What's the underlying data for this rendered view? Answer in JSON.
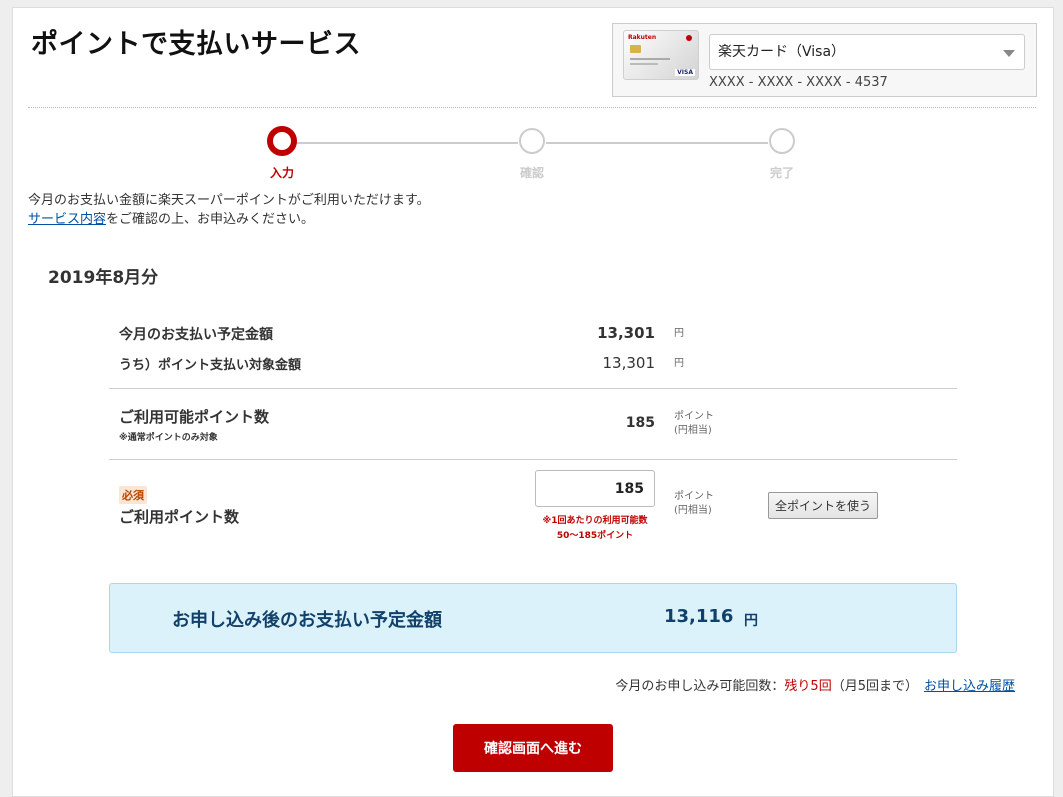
{
  "header": {
    "title": "ポイントで支払いサービス"
  },
  "card": {
    "brand_text": "Rakuten",
    "network_text": "VISA",
    "selected": "楽天カード（Visa）",
    "number": "XXXX - XXXX - XXXX - 4537"
  },
  "steps": [
    {
      "label": "入力",
      "state": "active"
    },
    {
      "label": "確認",
      "state": "inactive"
    },
    {
      "label": "完了",
      "state": "inactive"
    }
  ],
  "intro": {
    "line1": "今月のお支払い金額に楽天スーパーポイントがご利用いただけます。",
    "link": "サービス内容",
    "line2_rest": "をご確認の上、お申込みください。"
  },
  "month": "2019年8月分",
  "summary": {
    "due_label": "今月のお支払い予定金額",
    "due_value": "13,301",
    "due_unit": "円",
    "target_label": "うち）ポイント支払い対象金額",
    "target_value": "13,301",
    "target_unit": "円",
    "available_label": "ご利用可能ポイント数",
    "available_note": "※通常ポイントのみ対象",
    "available_value": "185",
    "available_unit1": "ポイント",
    "available_unit2": "(円相当)"
  },
  "usage": {
    "required_badge": "必須",
    "label": "ご利用ポイント数",
    "input_value": "185",
    "note_line1": "※1回あたりの利用可能数",
    "note_line2": "50〜185ポイント",
    "unit1": "ポイント",
    "unit2": "(円相当)",
    "use_all_button": "全ポイントを使う"
  },
  "result": {
    "label": "お申し込み後のお支払い予定金額",
    "value": "13,116",
    "unit": "円"
  },
  "apply_info": {
    "prefix": "今月のお申し込み可能回数：",
    "remaining": "残り5回",
    "limit": "（月5回まで）",
    "history_link": "お申し込み履歴"
  },
  "confirm_button": "確認画面へ進む",
  "colors": {
    "accent": "#bf0000",
    "link": "#0050a0",
    "result_bg": "#dbf2fb"
  }
}
